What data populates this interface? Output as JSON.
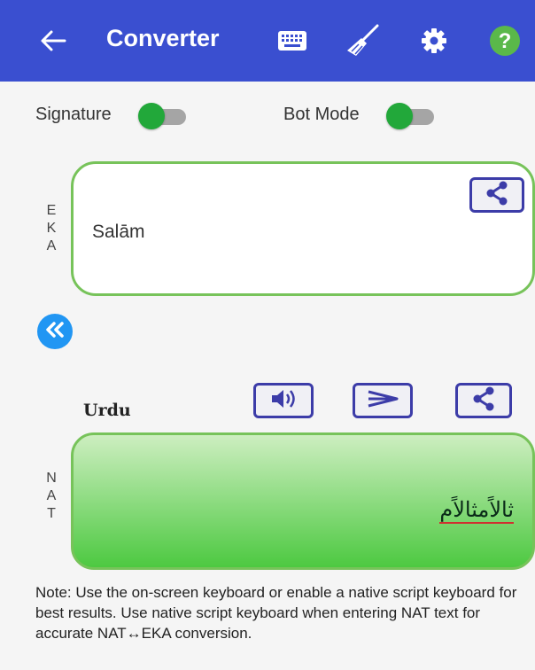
{
  "appbar": {
    "title": "Converter",
    "icons": [
      "back-arrow-icon",
      "keyboard-icon",
      "broom-icon",
      "gear-icon",
      "help-icon"
    ],
    "help_glyph": "?",
    "color": "#3a4fd0"
  },
  "toggles": {
    "signature_label": "Signature",
    "signature_on": true,
    "bot_mode_label": "Bot Mode",
    "bot_mode_on": true
  },
  "eka": {
    "side_label": [
      "E",
      "K",
      "A"
    ],
    "text": "Salām"
  },
  "nat": {
    "language": "Urdu",
    "side_label": [
      "N",
      "A",
      "T"
    ],
    "text": "ثالاًمثالاًم"
  },
  "buttons": {
    "speak_icon": "speaker-icon",
    "send_icon": "send-icon",
    "share_icon": "share-icon",
    "swap_icon": "double-chevron-left-icon"
  },
  "note": "Note: Use the on-screen keyboard or enable a native script keyboard for best results. Use native script keyboard when entering NAT text for accurate NAT↔EKA conversion.",
  "colors": {
    "accent_green": "#22a83a",
    "border_green": "#77c35a",
    "swap_blue": "#2196f3",
    "button_border": "#3c3ca8"
  }
}
